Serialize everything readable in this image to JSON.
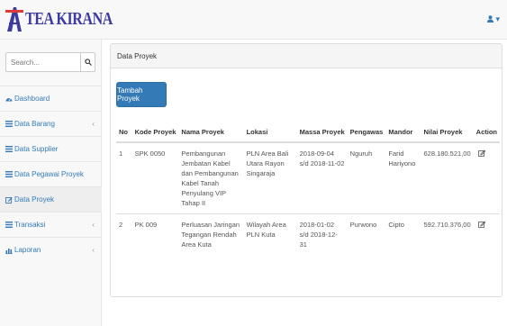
{
  "brand": {
    "name": "TEA KIRANA"
  },
  "user_menu": {
    "icon": "user-icon",
    "caret": "▾"
  },
  "sidebar": {
    "search": {
      "placeholder": "Search...",
      "icon": "search-icon"
    },
    "items": [
      {
        "label": "Dashboard",
        "icon": "dashboard-icon",
        "has_children": false,
        "active": false
      },
      {
        "label": "Data Barang",
        "icon": "list-icon",
        "has_children": true,
        "active": false
      },
      {
        "label": "Data Supplier",
        "icon": "list-icon",
        "has_children": false,
        "active": false
      },
      {
        "label": "Data Pegawai Proyek",
        "icon": "list-icon",
        "has_children": false,
        "active": false
      },
      {
        "label": "Data Proyek",
        "icon": "edit-icon",
        "has_children": false,
        "active": true
      },
      {
        "label": "Transaksi",
        "icon": "list-icon",
        "has_children": true,
        "active": false
      },
      {
        "label": "Laporan",
        "icon": "bar-chart-icon",
        "has_children": true,
        "active": false
      }
    ]
  },
  "panel": {
    "heading": "Data Proyek",
    "add_button_label": "Tambah Proyek"
  },
  "table": {
    "headers": [
      "No",
      "Kode Proyek",
      "Nama Proyek",
      "Lokasi",
      "Massa Proyek",
      "Pengawas",
      "Mandor",
      "Nilai Proyek",
      "Action"
    ],
    "rows": [
      {
        "no": "1",
        "kode": "SPK 0050",
        "nama": "Pembangunan Jembatan Kabel dan Pembangunan Kabel Tanah Penyulang VIP Tahap II",
        "lokasi": "PLN Area Bali Utara Rayon Singaraja",
        "massa": "2018-09-04 s/d 2018-11-02",
        "pengawas": "Nguruh",
        "mandor": "Farid Hariyono",
        "nilai": "628.180.521,00"
      },
      {
        "no": "2",
        "kode": "PK 009",
        "nama": "Perluasan Jaringan Tegangan Rendah Area Kuta",
        "lokasi": "Wilayah Area PLN Kuta",
        "massa": "2018-01-02 s/d 2018-12-31",
        "pengawas": "Purwono",
        "mandor": "Cipto",
        "nilai": "592.710.376,00"
      }
    ]
  },
  "colors": {
    "link": "#337ab7",
    "primary": "#337ab7",
    "brand": "#3d3aa0"
  }
}
